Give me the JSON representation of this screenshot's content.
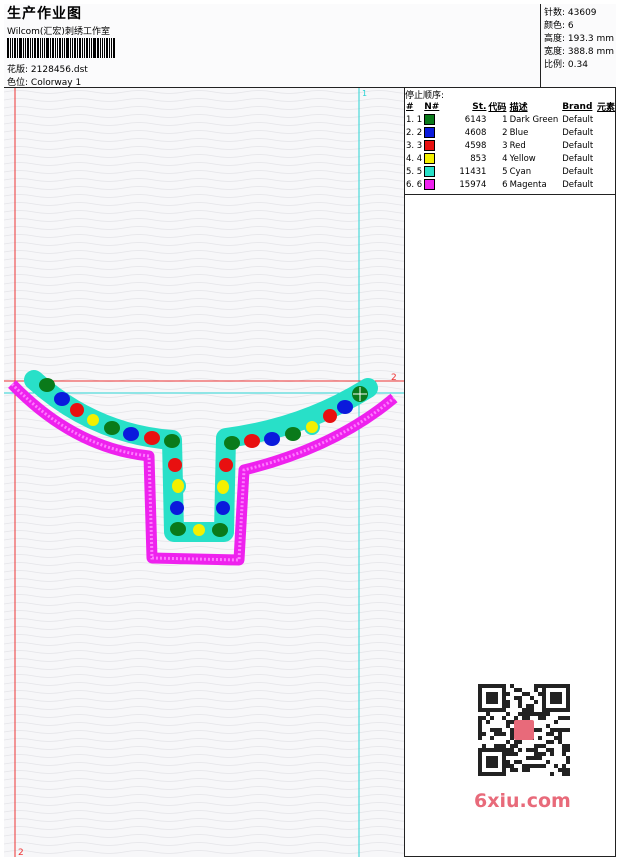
{
  "header": {
    "title": "生产作业图",
    "company": "Wilcom(汇宏)刺绣工作室",
    "design_label": "花版:",
    "design_value": "2128456.dst",
    "colorway_label": "色位:",
    "colorway_value": "Colorway 1"
  },
  "stats": {
    "stitches": "针数: 43609",
    "colors": "颜色: 6",
    "height": "高度: 193.3 mm",
    "width": "宽度: 388.8 mm",
    "scale": "比例: 0.34"
  },
  "stop_sequence": {
    "title": "停止顺序:",
    "headers": [
      "#",
      "N#",
      "St.",
      "代码",
      "描述",
      "Brand",
      "元素"
    ],
    "rows": [
      {
        "idx": "1. 1",
        "st": "6143",
        "code": "1",
        "desc": "Dark Green",
        "brand": "Default",
        "color": "#0a7a1a"
      },
      {
        "idx": "2. 2",
        "st": "4608",
        "code": "2",
        "desc": "Blue",
        "brand": "Default",
        "color": "#0a1adc"
      },
      {
        "idx": "3. 3",
        "st": "4598",
        "code": "3",
        "desc": "Red",
        "brand": "Default",
        "color": "#e81010"
      },
      {
        "idx": "4. 4",
        "st": "853",
        "code": "4",
        "desc": "Yellow",
        "brand": "Default",
        "color": "#f4f000"
      },
      {
        "idx": "5. 5",
        "st": "11431",
        "code": "5",
        "desc": "Cyan",
        "brand": "Default",
        "color": "#28e0c8"
      },
      {
        "idx": "6. 6",
        "st": "15974",
        "code": "6",
        "desc": "Magenta",
        "brand": "Default",
        "color": "#ee22ee"
      }
    ]
  },
  "canvas": {
    "guide_markers": [
      "1",
      "2",
      "2"
    ]
  },
  "watermark": {
    "text": "6xiu.com"
  }
}
